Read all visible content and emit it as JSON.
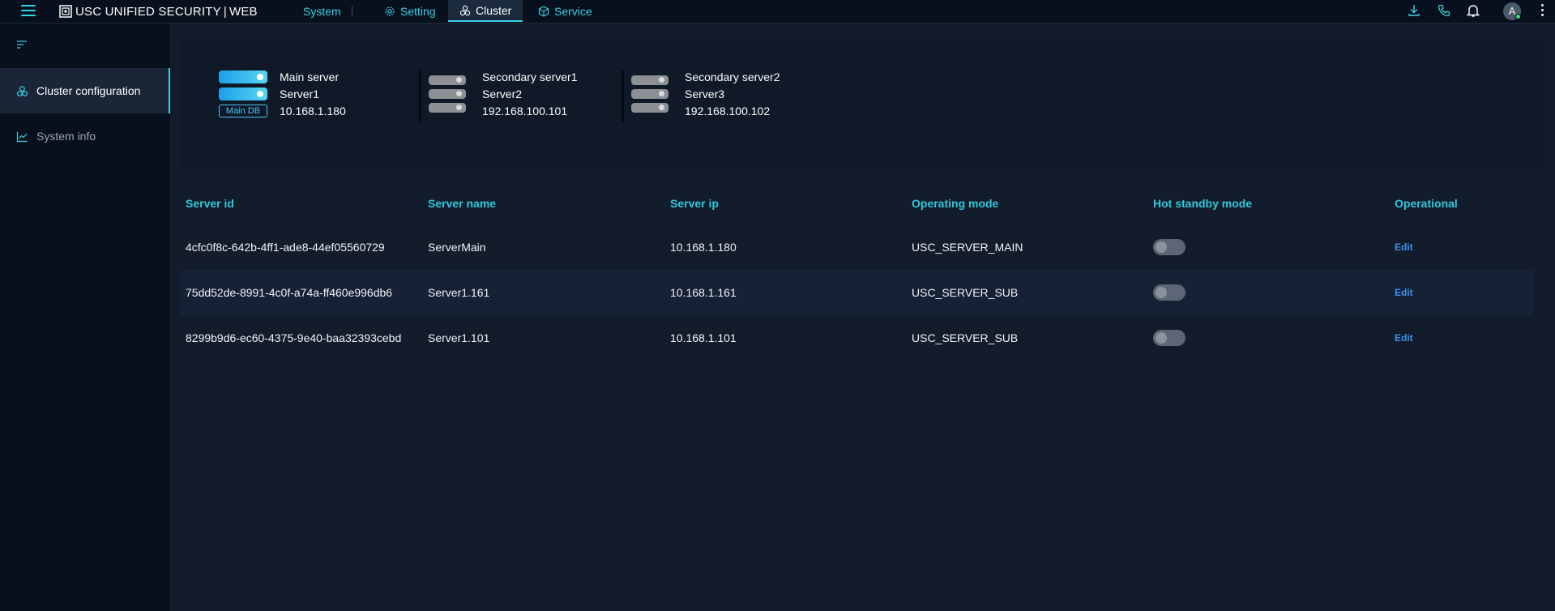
{
  "app": {
    "brand_name": "USC UNIFIED SECURITY",
    "brand_separator": "|",
    "brand_suffix": "WEB"
  },
  "nav": {
    "system": "System",
    "setting": "Setting",
    "cluster": "Cluster",
    "service": "Service"
  },
  "user": {
    "avatar_letter": "A"
  },
  "sidebar": {
    "items": [
      {
        "label": "Cluster configuration",
        "icon": "cluster-icon",
        "active": true
      },
      {
        "label": "System info",
        "icon": "line-chart-icon",
        "active": false
      }
    ]
  },
  "servers": [
    {
      "role": "Main server",
      "name": "Server1",
      "ip": "10.168.1.180",
      "badge": "Main DB"
    },
    {
      "role": "Secondary server1",
      "name": "Server2",
      "ip": "192.168.100.101"
    },
    {
      "role": "Secondary server2",
      "name": "Server3",
      "ip": "192.168.100.102"
    }
  ],
  "table": {
    "headers": [
      "Server id",
      "Server name",
      "Server ip",
      "Operating mode",
      "Hot standby mode",
      "Operational"
    ],
    "rows": [
      {
        "id": "4cfc0f8c-642b-4ff1-ade8-44ef05560729",
        "name": "ServerMain",
        "ip": "10.168.1.180",
        "mode": "USC_SERVER_MAIN",
        "hot_standby": false,
        "action": "Edit"
      },
      {
        "id": "75dd52de-8991-4c0f-a74a-ff460e996db6",
        "name": "Server1.161",
        "ip": "10.168.1.161",
        "mode": "USC_SERVER_SUB",
        "hot_standby": false,
        "action": "Edit"
      },
      {
        "id": "8299b9d6-ec60-4375-9e40-baa32393cebd",
        "name": "Server1.101",
        "ip": "10.168.1.101",
        "mode": "USC_SERVER_SUB",
        "hot_standby": false,
        "action": "Edit"
      }
    ]
  },
  "colors": {
    "accent": "#3ad1e6",
    "background": "#0b1523",
    "link": "#3f8ff0"
  }
}
